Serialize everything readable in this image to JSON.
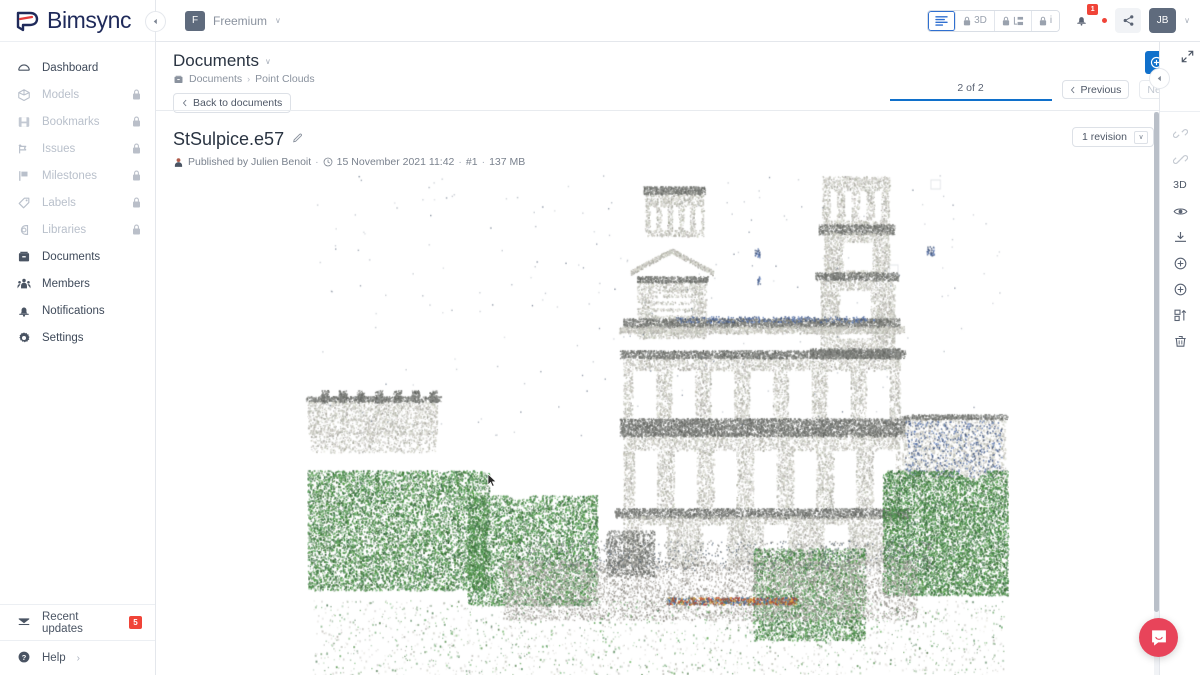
{
  "brand": {
    "name": "Bimsync",
    "logo_icon": "bimsync-logo-icon"
  },
  "sidebar": {
    "items": [
      {
        "label": "Dashboard",
        "icon": "dashboard-icon",
        "locked": false
      },
      {
        "label": "Models",
        "icon": "cube-icon",
        "locked": true
      },
      {
        "label": "Bookmarks",
        "icon": "bookmark-icon",
        "locked": true
      },
      {
        "label": "Issues",
        "icon": "issue-flag-icon",
        "locked": true
      },
      {
        "label": "Milestones",
        "icon": "milestone-flag-icon",
        "locked": true
      },
      {
        "label": "Labels",
        "icon": "tag-icon",
        "locked": true
      },
      {
        "label": "Libraries",
        "icon": "library-icon",
        "locked": true
      },
      {
        "label": "Documents",
        "icon": "documents-icon",
        "locked": false
      },
      {
        "label": "Members",
        "icon": "members-icon",
        "locked": false
      },
      {
        "label": "Notifications",
        "icon": "bell-icon",
        "locked": false
      },
      {
        "label": "Settings",
        "icon": "gear-icon",
        "locked": false
      }
    ],
    "bottom": [
      {
        "label": "Recent updates",
        "icon": "envelope-icon",
        "badge": "5"
      },
      {
        "label": "Help",
        "icon": "help-circle-icon",
        "chevron": "›"
      }
    ]
  },
  "topbar": {
    "collapse_icon": "collapse-left-icon",
    "project": {
      "initial": "F",
      "name": "Freemium",
      "caret": "∨"
    },
    "view_modes": [
      {
        "label": "",
        "icon": "document-list-icon",
        "locked": false,
        "active": true
      },
      {
        "label": "3D",
        "icon": "lock-icon",
        "locked": true,
        "active": false
      },
      {
        "label": "",
        "icon": "structure-tree-icon",
        "locked": true,
        "active": false
      },
      {
        "label": "i",
        "icon": "lock-icon",
        "locked": true,
        "active": false
      }
    ],
    "notifications": {
      "icon": "bell-icon",
      "count": "1"
    },
    "share": {
      "icon": "share-icon",
      "has_dot": true
    },
    "user": {
      "initials": "JB",
      "caret": "∨"
    }
  },
  "page": {
    "title": "Documents",
    "title_caret": "∨",
    "breadcrumb": [
      "Documents",
      "Point Clouds"
    ],
    "breadcrumb_icon": "folder-icon",
    "breadcrumb_separator": "›",
    "back_button": {
      "label": "Back to documents",
      "icon": "chevron-left-icon"
    },
    "add_button": {
      "icon": "plus-circle-icon"
    },
    "more_button": {
      "icon": "kebab-menu-icon"
    },
    "counter": "2 of 2",
    "previous_button": {
      "label": "Previous",
      "icon": "chevron-left-icon"
    },
    "next_button": {
      "label": "Next",
      "icon": "chevron-right-icon",
      "disabled": true
    }
  },
  "document": {
    "name": "StSulpice.e57",
    "edit_icon": "pencil-icon",
    "meta": {
      "author_icon": "user-avatar-icon",
      "published_by": "Published by Julien Benoit",
      "clock_icon": "clock-icon",
      "date": "15 November 2021 11:42",
      "revision": "#1",
      "size": "137 MB",
      "separator": "·"
    },
    "revision_selector": {
      "label": "1 revision",
      "caret": "∨"
    }
  },
  "right_rail": {
    "expand_icon": "expand-diagonal-icon",
    "collapse_icon": "collapse-right-icon",
    "buttons": [
      {
        "icon": "link-broken-icon",
        "label": "",
        "muted": true
      },
      {
        "icon": "link-icon",
        "label": "",
        "muted": true
      },
      {
        "icon": "3d-view-icon",
        "label": "3D",
        "muted": false
      },
      {
        "icon": "eye-icon",
        "label": "",
        "muted": false
      },
      {
        "icon": "download-icon",
        "label": "",
        "muted": false
      },
      {
        "icon": "plus-circle-icon",
        "label": "",
        "muted": false
      },
      {
        "icon": "plus-circle-icon",
        "label": "",
        "muted": false
      },
      {
        "icon": "move-file-icon",
        "label": "",
        "muted": false
      },
      {
        "icon": "trash-icon",
        "label": "",
        "muted": false
      }
    ]
  },
  "messenger": {
    "icon": "intercom-chat-icon",
    "color": "#e8445a"
  },
  "viewer": {
    "content_description": "Point cloud of the Saint-Sulpice church facade with towers, colonnades and surrounding trees",
    "cursor_icon": "mouse-pointer-icon"
  },
  "colors": {
    "accent_blue": "#1070cb",
    "danger_red": "#f04438",
    "messenger_red": "#e8445a",
    "brand_navy": "#1f2a5a",
    "text_primary": "#2a3442",
    "text_muted": "#8a929e",
    "border": "#e4e7ec"
  }
}
